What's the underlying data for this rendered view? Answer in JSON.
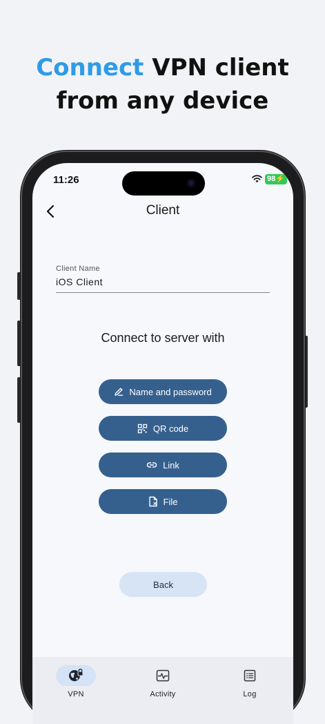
{
  "headline": {
    "accent": "Connect",
    "line1_rest": "VPN client",
    "line2": "from any device"
  },
  "status_bar": {
    "time": "11:26",
    "battery": "98"
  },
  "nav": {
    "title": "Client",
    "back_icon": "chevron-left-icon"
  },
  "client_name": {
    "label": "Client Name",
    "value": "iOS Client"
  },
  "connect": {
    "heading": "Connect to server with",
    "options": [
      {
        "label": "Name and password",
        "icon": "pencil-icon"
      },
      {
        "label": "QR code",
        "icon": "qr-code-icon"
      },
      {
        "label": "Link",
        "icon": "link-icon"
      },
      {
        "label": "File",
        "icon": "file-icon"
      }
    ]
  },
  "back_button": {
    "label": "Back"
  },
  "tabs": [
    {
      "label": "VPN",
      "icon": "globe-lock-icon",
      "active": true
    },
    {
      "label": "Activity",
      "icon": "activity-icon",
      "active": false
    },
    {
      "label": "Log",
      "icon": "list-icon",
      "active": false
    }
  ],
  "colors": {
    "accent": "#2f9be6",
    "primary_button": "#35608e",
    "secondary_button": "#d6e4f5",
    "battery": "#34c759"
  }
}
